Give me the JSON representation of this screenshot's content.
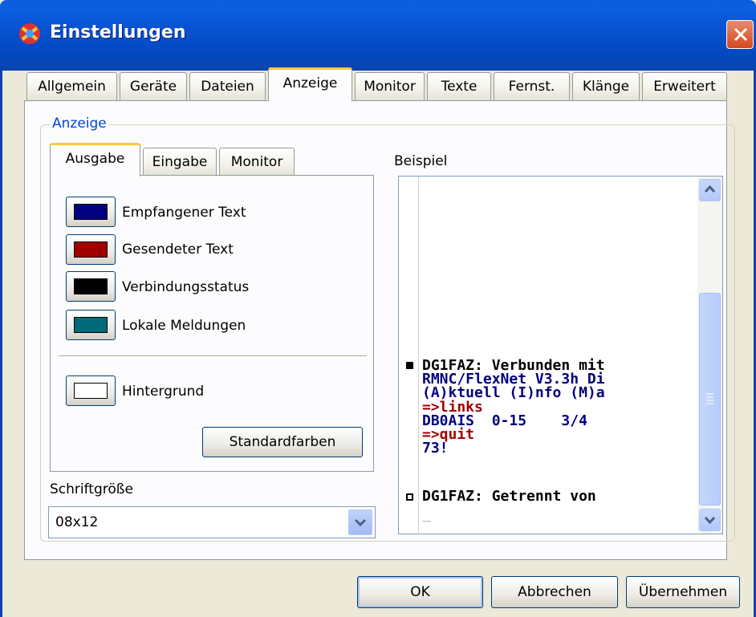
{
  "window": {
    "title": "Einstellungen"
  },
  "tabs": [
    "Allgemein",
    "Geräte",
    "Dateien",
    "Anzeige",
    "Monitor",
    "Texte",
    "Fernst.",
    "Klänge",
    "Erweitert"
  ],
  "active_tab": "Anzeige",
  "group": {
    "label": "Anzeige"
  },
  "inner_tabs": [
    "Ausgabe",
    "Eingabe",
    "Monitor"
  ],
  "active_inner_tab": "Ausgabe",
  "colors": [
    {
      "label": "Empfangener Text",
      "color": "#000080"
    },
    {
      "label": "Gesendeter Text",
      "color": "#a00000"
    },
    {
      "label": "Verbindungsstatus",
      "color": "#000000"
    },
    {
      "label": "Lokale Meldungen",
      "color": "#006a7a"
    }
  ],
  "background": {
    "label": "Hintergrund",
    "color": "#ffffff"
  },
  "standard_button": "Standardfarben",
  "font_size": {
    "label": "Schriftgröße",
    "value": "08x12"
  },
  "preview": {
    "label": "Beispiel",
    "lines": [
      {
        "text": "DG1FAZ: Verbunden mit",
        "color": "#000000",
        "marker": "filled"
      },
      {
        "text": "RMNC/FlexNet V3.3h Di",
        "color": "#000080"
      },
      {
        "text": "(A)ktuell (I)nfo (M)a",
        "color": "#000080"
      },
      {
        "text": "=>links",
        "color": "#a00000"
      },
      {
        "text": "DB0AIS  0-15    3/4",
        "color": "#000080"
      },
      {
        "text": "=>quit",
        "color": "#a00000"
      },
      {
        "text": "73!",
        "color": "#000080"
      },
      {
        "text": "DG1FAZ: Getrennt von",
        "color": "#000000",
        "marker": "boxed"
      },
      {
        "text": "_",
        "color": "#888888"
      }
    ]
  },
  "buttons": {
    "ok": "OK",
    "cancel": "Abbrechen",
    "apply": "Übernehmen"
  }
}
